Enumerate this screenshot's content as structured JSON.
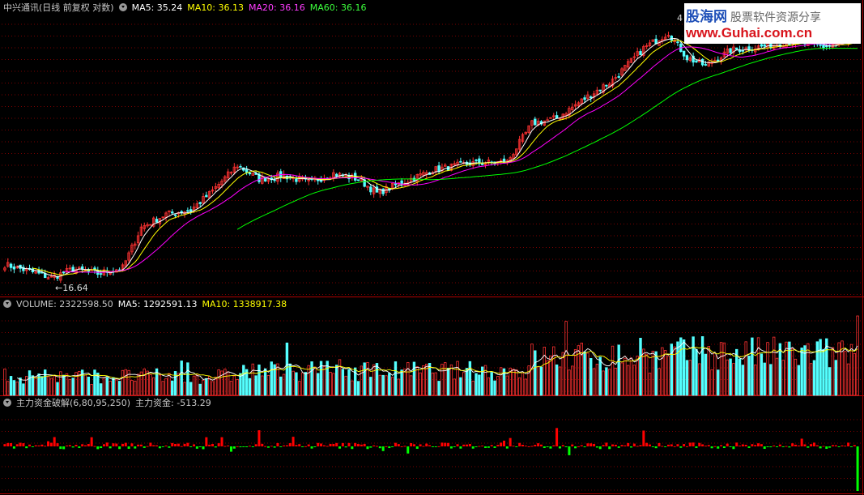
{
  "header_main": {
    "title": "中兴通讯(日线 前复权 对数)",
    "ma5": "MA5: 35.24",
    "ma10": "MA10: 36.13",
    "ma20": "MA20: 36.16",
    "ma60": "MA60: 36.16"
  },
  "header_volume": {
    "title": "VOLUME: 2322598.50",
    "ma5": "MA5: 1292591.13",
    "ma10": "MA10: 1338917.38"
  },
  "header_indicator": {
    "title": "主力资金破解(6,80,95,250)",
    "value": "主力资金: -513.29"
  },
  "watermark": {
    "brand": "股海网",
    "slogan": "股票软件资源分享",
    "url": "www.Guhai.com.cn"
  },
  "colors": {
    "up": "#ff3232",
    "down": "#54ffff",
    "ma5": "#ffffff",
    "ma10": "#ffff00",
    "ma20": "#ff00ff",
    "ma60": "#00ff00",
    "fund_pos": "#ff0000",
    "fund_neg": "#00ff00",
    "grid": "#7a0000",
    "border": "#b00000"
  },
  "chart_data": [
    {
      "type": "candlestick",
      "title": "中兴通讯(日线 前复权 对数)",
      "scale": "log",
      "annotations": [
        {
          "text": "16.64",
          "kind": "low"
        },
        {
          "text": "4",
          "kind": "high"
        }
      ],
      "price_path": [
        [
          0,
          17.8
        ],
        [
          8,
          17.2
        ],
        [
          15,
          16.64
        ],
        [
          22,
          17.4
        ],
        [
          30,
          17.0
        ],
        [
          38,
          17.5
        ],
        [
          44,
          21.5
        ],
        [
          52,
          23.0
        ],
        [
          60,
          23.5
        ],
        [
          66,
          25.5
        ],
        [
          75,
          29.5
        ],
        [
          82,
          27.5
        ],
        [
          90,
          28.0
        ],
        [
          98,
          27.0
        ],
        [
          106,
          28.3
        ],
        [
          114,
          27.5
        ],
        [
          120,
          25.6
        ],
        [
          128,
          27.0
        ],
        [
          138,
          28.8
        ],
        [
          150,
          29.8
        ],
        [
          162,
          30.0
        ],
        [
          170,
          36.5
        ],
        [
          178,
          37.5
        ],
        [
          186,
          41.0
        ],
        [
          196,
          45.5
        ],
        [
          206,
          53.5
        ],
        [
          214,
          58.0
        ],
        [
          220,
          51.0
        ],
        [
          226,
          49.0
        ],
        [
          234,
          53.0
        ],
        [
          244,
          54.0
        ],
        [
          254,
          55.5
        ],
        [
          264,
          54.0
        ],
        [
          275,
          55.5
        ]
      ],
      "series_lines": [
        "MA5",
        "MA10",
        "MA20",
        "MA60"
      ]
    },
    {
      "type": "bar",
      "title": "VOLUME",
      "values_desc": "daily volume bars with MA5/MA10 lines",
      "last_value": 2322598.5
    },
    {
      "type": "bar",
      "title": "主力资金破解(6,80,95,250)",
      "last_value": -513.29
    }
  ]
}
